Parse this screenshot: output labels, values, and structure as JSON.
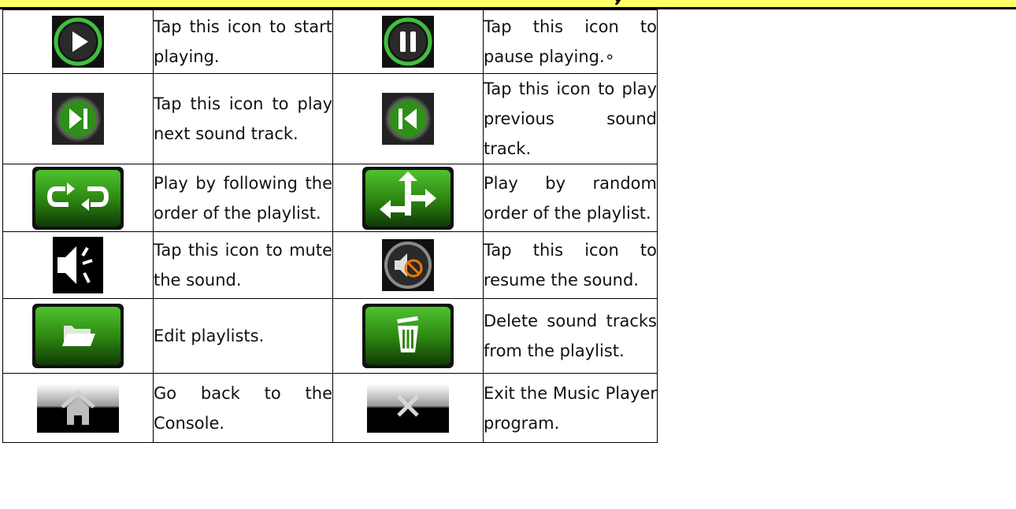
{
  "rows": [
    {
      "left": {
        "icon": "play-icon",
        "text": "Tap this icon to start playing."
      },
      "right": {
        "icon": "pause-icon",
        "text": "Tap this icon to pause playing.∘"
      }
    },
    {
      "left": {
        "icon": "next-track-icon",
        "text": "Tap this icon to play next sound track."
      },
      "right": {
        "icon": "previous-track-icon",
        "text": "Tap this icon to play previous sound track."
      }
    },
    {
      "left": {
        "icon": "repeat-order-icon",
        "text": "Play by following the order of the playlist."
      },
      "right": {
        "icon": "shuffle-icon",
        "text": "Play by random order of the playlist."
      }
    },
    {
      "left": {
        "icon": "mute-icon",
        "text": "Tap this icon to mute the sound."
      },
      "right": {
        "icon": "unmute-icon",
        "text": "Tap this icon to resume the sound."
      }
    },
    {
      "left": {
        "icon": "folder-icon",
        "text": "Edit playlists."
      },
      "right": {
        "icon": "trash-icon",
        "text": "Delete sound tracks from the playlist."
      }
    },
    {
      "left": {
        "icon": "home-icon",
        "text": "Go back to the Console."
      },
      "right": {
        "icon": "close-icon",
        "text": "Exit the Music Player program."
      }
    }
  ],
  "colors": {
    "header_bar": "#ffff66",
    "green_button": "#2e8a12",
    "green_ring": "#3fbf3f",
    "dark_button": "#1a1a1a"
  }
}
